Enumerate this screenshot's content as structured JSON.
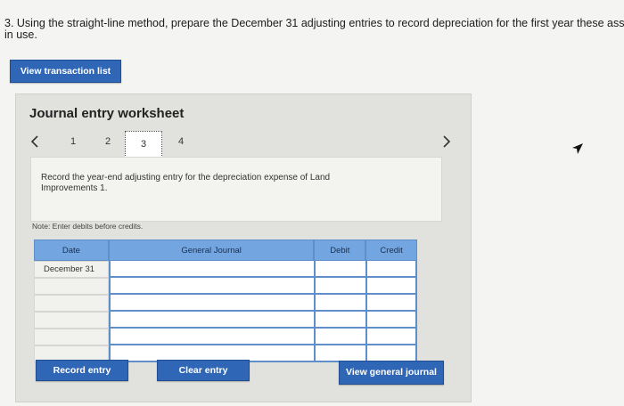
{
  "question": {
    "line1": "3. Using the straight-line method, prepare the December 31 adjusting entries to record depreciation for the first year these ass",
    "line2": "in use."
  },
  "buttons": {
    "view_transaction_list": "View transaction list",
    "record_entry": "Record entry",
    "clear_entry": "Clear entry",
    "view_general_journal": "View general journal"
  },
  "worksheet": {
    "title": "Journal entry worksheet",
    "pages": [
      "1",
      "2",
      "3",
      "4"
    ],
    "active_page": "3",
    "prev_icon": "chevron-left-icon",
    "next_icon": "chevron-right-icon",
    "instruction": "Record the year-end adjusting entry for the depreciation expense of Land Improvements 1.",
    "note": "Note: Enter debits before credits."
  },
  "journal": {
    "headers": {
      "date": "Date",
      "general_journal": "General Journal",
      "debit": "Debit",
      "credit": "Credit"
    },
    "rows": [
      {
        "date": "December 31",
        "account": "",
        "debit": "",
        "credit": ""
      },
      {
        "date": "",
        "account": "",
        "debit": "",
        "credit": ""
      },
      {
        "date": "",
        "account": "",
        "debit": "",
        "credit": ""
      },
      {
        "date": "",
        "account": "",
        "debit": "",
        "credit": ""
      },
      {
        "date": "",
        "account": "",
        "debit": "",
        "credit": ""
      },
      {
        "date": "",
        "account": "",
        "debit": "",
        "credit": ""
      }
    ]
  },
  "colors": {
    "primary_button": "#2f67b6",
    "table_header": "#73a6e0",
    "worksheet_bg": "#e1e1de"
  }
}
